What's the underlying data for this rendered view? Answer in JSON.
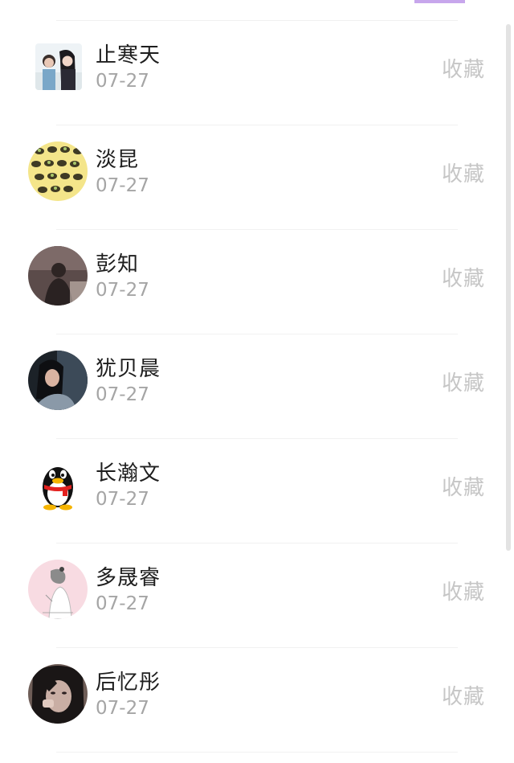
{
  "favorite_label": "收藏",
  "colors": {
    "accent": "#c7a6ec",
    "name": "#1e1e1e",
    "date": "#a5a5a5",
    "favorite": "#c6c6c6"
  },
  "contacts": [
    {
      "name": "止寒天",
      "date": "07-27",
      "avatar_icon": "couple-photo-avatar"
    },
    {
      "name": "淡昆",
      "date": "07-27",
      "avatar_icon": "pattern-avatar"
    },
    {
      "name": "彭知",
      "date": "07-27",
      "avatar_icon": "dark-photo-avatar"
    },
    {
      "name": "犹贝晨",
      "date": "07-27",
      "avatar_icon": "girl-photo-avatar"
    },
    {
      "name": "长瀚文",
      "date": "07-27",
      "avatar_icon": "qq-penguin-avatar"
    },
    {
      "name": "多晟睿",
      "date": "07-27",
      "avatar_icon": "pink-sketch-avatar"
    },
    {
      "name": "后忆彤",
      "date": "07-27",
      "avatar_icon": "portrait-photo-avatar"
    }
  ]
}
